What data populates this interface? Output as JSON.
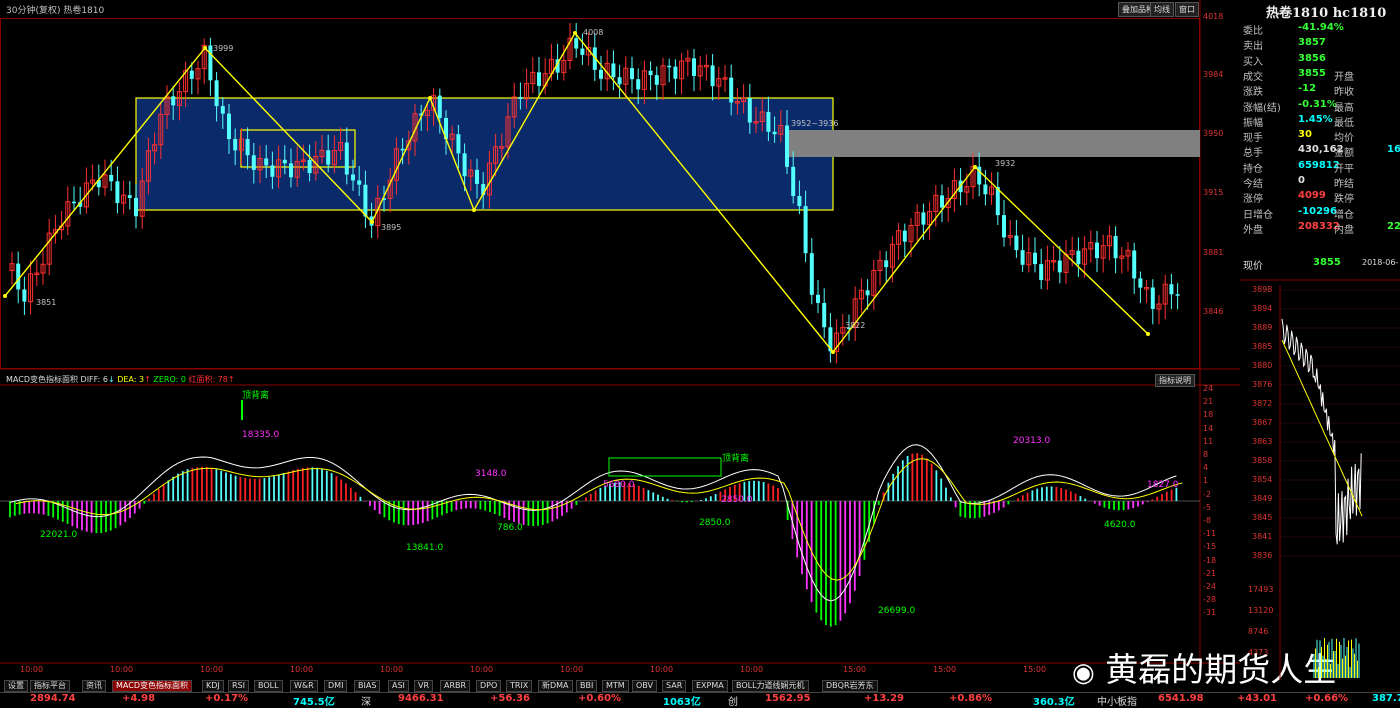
{
  "chart_header": {
    "title": "30分钟(复权)  热卷1810",
    "buttons": [
      "叠加品种",
      "均线",
      "窗口"
    ]
  },
  "price_axis": [
    "4018",
    "3984",
    "3950",
    "3915",
    "3881",
    "3846"
  ],
  "annotations": {
    "low_3851": "3851",
    "high_3999": "3999",
    "low_3895": "3895",
    "high_4008": "4008",
    "gap": "3952~3936",
    "low_3822": "3822",
    "high_3932": "3932"
  },
  "macd": {
    "header_label": "MACD变色指标面积",
    "diff": "DIFF: 6",
    "dea": "DEA: 3",
    "zero": "ZERO: 0",
    "red_area": "红面积: 78",
    "help_button": "指标说明",
    "axis": [
      "24",
      "21",
      "18",
      "14",
      "11",
      "8",
      "4",
      "1",
      "-2",
      "-5",
      "-8",
      "-11",
      "-15",
      "-18",
      "-21",
      "-24",
      "-28",
      "-31"
    ],
    "labels": {
      "top_div_1": "顶背离",
      "top_div_2": "顶背离",
      "a1": "22021.0",
      "a2": "18335.0",
      "a3": "13841.0",
      "a4": "3148.0",
      "a5": "786.0",
      "a6": "5680.0",
      "a7": "2850.0",
      "a8": "2850.0",
      "a9": "26699.0",
      "a10": "20313.0",
      "a11": "4620.0",
      "a12": "1827.0"
    }
  },
  "time_axis": [
    "10:00",
    "10:00",
    "10:00",
    "10:00",
    "10:00",
    "10:00",
    "10:00",
    "10:00",
    "10:00",
    "15:00",
    "15:00",
    "15:00"
  ],
  "tabs": [
    "设置",
    "指标平台",
    "资讯",
    "MACD变色指标面积",
    "KDJ",
    "RSI",
    "BOLL",
    "W&R",
    "DMI",
    "BIAS",
    "ASI",
    "VR",
    "ARBR",
    "DPO",
    "TRIX",
    "新DMA",
    "BBI",
    "MTM",
    "OBV",
    "SAR",
    "EXPMA",
    "BOLL力道线娴元机",
    "DBQR岩芳东"
  ],
  "status_bar": {
    "v1": "2894.74",
    "v2": "+4.98",
    "v3": "+0.17%",
    "v4": "745.5亿",
    "lbl_shen": "深",
    "v5": "9466.31",
    "v6": "+56.36",
    "v7": "+0.60%",
    "v8": "1063亿",
    "lbl_chuang": "创",
    "v9": "1562.95",
    "v10": "+13.29",
    "v11": "+0.86%",
    "v12": "360.3亿",
    "lbl_zxb": "中小板指",
    "v13": "6541.98",
    "v14": "+43.01",
    "v15": "+0.66%",
    "v16": "387.7"
  },
  "quote_panel": {
    "title": "热卷1810 hc1810",
    "rows": [
      {
        "l1": "委比",
        "v1": "-41.94%",
        "c1": "#33ff33",
        "l2": "",
        "v2": "",
        "c2": ""
      },
      {
        "l1": "卖出",
        "v1": "3857",
        "c1": "#33ff33",
        "l2": "",
        "v2": "",
        "c2": ""
      },
      {
        "l1": "买入",
        "v1": "3856",
        "c1": "#33ff33",
        "l2": "",
        "v2": "",
        "c2": ""
      },
      {
        "l1": "成交",
        "v1": "3855",
        "c1": "#33ff33",
        "l2": "开盘",
        "v2": "",
        "c2": ""
      },
      {
        "l1": "涨跌",
        "v1": "-12",
        "c1": "#33ff33",
        "l2": "昨收",
        "v2": "",
        "c2": ""
      },
      {
        "l1": "涨幅(结)",
        "v1": "-0.31%",
        "c1": "#33ff33",
        "l2": "最高",
        "v2": "",
        "c2": ""
      },
      {
        "l1": "振幅",
        "v1": "1.45%",
        "c1": "#00ffff",
        "l2": "最低",
        "v2": "",
        "c2": ""
      },
      {
        "l1": "现手",
        "v1": "30",
        "c1": "#ffff00",
        "l2": "均价",
        "v2": "",
        "c2": ""
      },
      {
        "l1": "总手",
        "v1": "430,162",
        "c1": "#e0e0e0",
        "l2": "金额",
        "v2": "16",
        "c2": "#00ffff"
      },
      {
        "l1": "持仓",
        "v1": "659812",
        "c1": "#00ffff",
        "l2": "开平",
        "v2": "",
        "c2": ""
      },
      {
        "l1": "今结",
        "v1": "0",
        "c1": "#e0e0e0",
        "l2": "昨结",
        "v2": "",
        "c2": ""
      },
      {
        "l1": "涨停",
        "v1": "4099",
        "c1": "#ff4040",
        "l2": "跌停",
        "v2": "",
        "c2": ""
      },
      {
        "l1": "日增仓",
        "v1": "-10296",
        "c1": "#00ffff",
        "l2": "增仓",
        "v2": "",
        "c2": ""
      },
      {
        "l1": "外盘",
        "v1": "208332",
        "c1": "#ff4040",
        "l2": "内盘",
        "v2": "22",
        "c2": "#33ff33"
      }
    ],
    "price_label": "现价",
    "price_value": "3855",
    "date": "2018-06-",
    "mini_axis": [
      "3898",
      "3894",
      "3889",
      "3885",
      "3880",
      "3876",
      "3872",
      "3867",
      "3863",
      "3858",
      "3854",
      "3849",
      "3845",
      "3841",
      "3836"
    ],
    "vol_axis": [
      "17493",
      "13120",
      "8746",
      "4373"
    ]
  },
  "watermark": "黄磊的期货人生",
  "colors": {
    "up": "#ff3030",
    "down": "#54ffff",
    "zigzag": "#ffff00",
    "box": "#ffff00",
    "box_fill": "#0a2a6a",
    "gap": "#808080",
    "hist_pos_red": "#ff2020",
    "hist_pos_cyan": "#54ffff",
    "hist_neg_green": "#00ff00",
    "hist_neg_magenta": "#ff33ff"
  }
}
